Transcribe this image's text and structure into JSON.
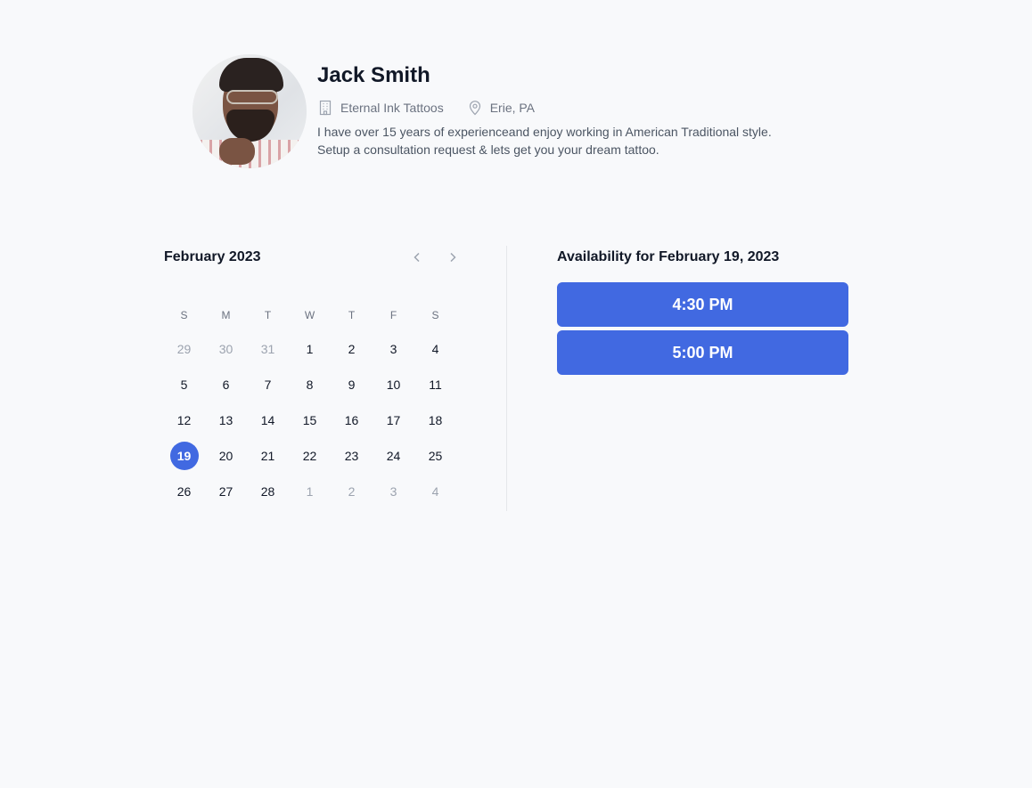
{
  "profile": {
    "name": "Jack Smith",
    "avatar_alt": "Portrait of Jack Smith",
    "studio": {
      "icon": "building-icon",
      "label": "Eternal Ink Tattoos"
    },
    "location": {
      "icon": "map-pin-icon",
      "label": "Erie, PA"
    },
    "bio_line1": "I have over 15 years of experienceand enjoy working in American Traditional style.",
    "bio_line2": "Setup a consultation request & lets get you your dream tattoo."
  },
  "calendar": {
    "month_label": "February 2023",
    "prev_icon": "chevron-left-icon",
    "next_icon": "chevron-right-icon",
    "weekdays": [
      "S",
      "M",
      "T",
      "W",
      "T",
      "F",
      "S"
    ],
    "selected_day": 19,
    "days": [
      {
        "label": "29",
        "muted": true
      },
      {
        "label": "30",
        "muted": true
      },
      {
        "label": "31",
        "muted": true
      },
      {
        "label": "1"
      },
      {
        "label": "2"
      },
      {
        "label": "3"
      },
      {
        "label": "4"
      },
      {
        "label": "5"
      },
      {
        "label": "6"
      },
      {
        "label": "7"
      },
      {
        "label": "8"
      },
      {
        "label": "9"
      },
      {
        "label": "10"
      },
      {
        "label": "11"
      },
      {
        "label": "12"
      },
      {
        "label": "13"
      },
      {
        "label": "14"
      },
      {
        "label": "15"
      },
      {
        "label": "16"
      },
      {
        "label": "17"
      },
      {
        "label": "18"
      },
      {
        "label": "19",
        "selected": true
      },
      {
        "label": "20"
      },
      {
        "label": "21"
      },
      {
        "label": "22"
      },
      {
        "label": "23"
      },
      {
        "label": "24"
      },
      {
        "label": "25"
      },
      {
        "label": "26"
      },
      {
        "label": "27"
      },
      {
        "label": "28"
      },
      {
        "label": "1",
        "muted": true
      },
      {
        "label": "2",
        "muted": true
      },
      {
        "label": "3",
        "muted": true
      },
      {
        "label": "4",
        "muted": true
      }
    ]
  },
  "availability": {
    "title": "Availability for February 19, 2023",
    "slots": [
      "4:30 PM",
      "5:00 PM"
    ]
  },
  "colors": {
    "accent": "#4169e1",
    "background": "#f8f9fb",
    "muted_text": "#9ca3af"
  }
}
